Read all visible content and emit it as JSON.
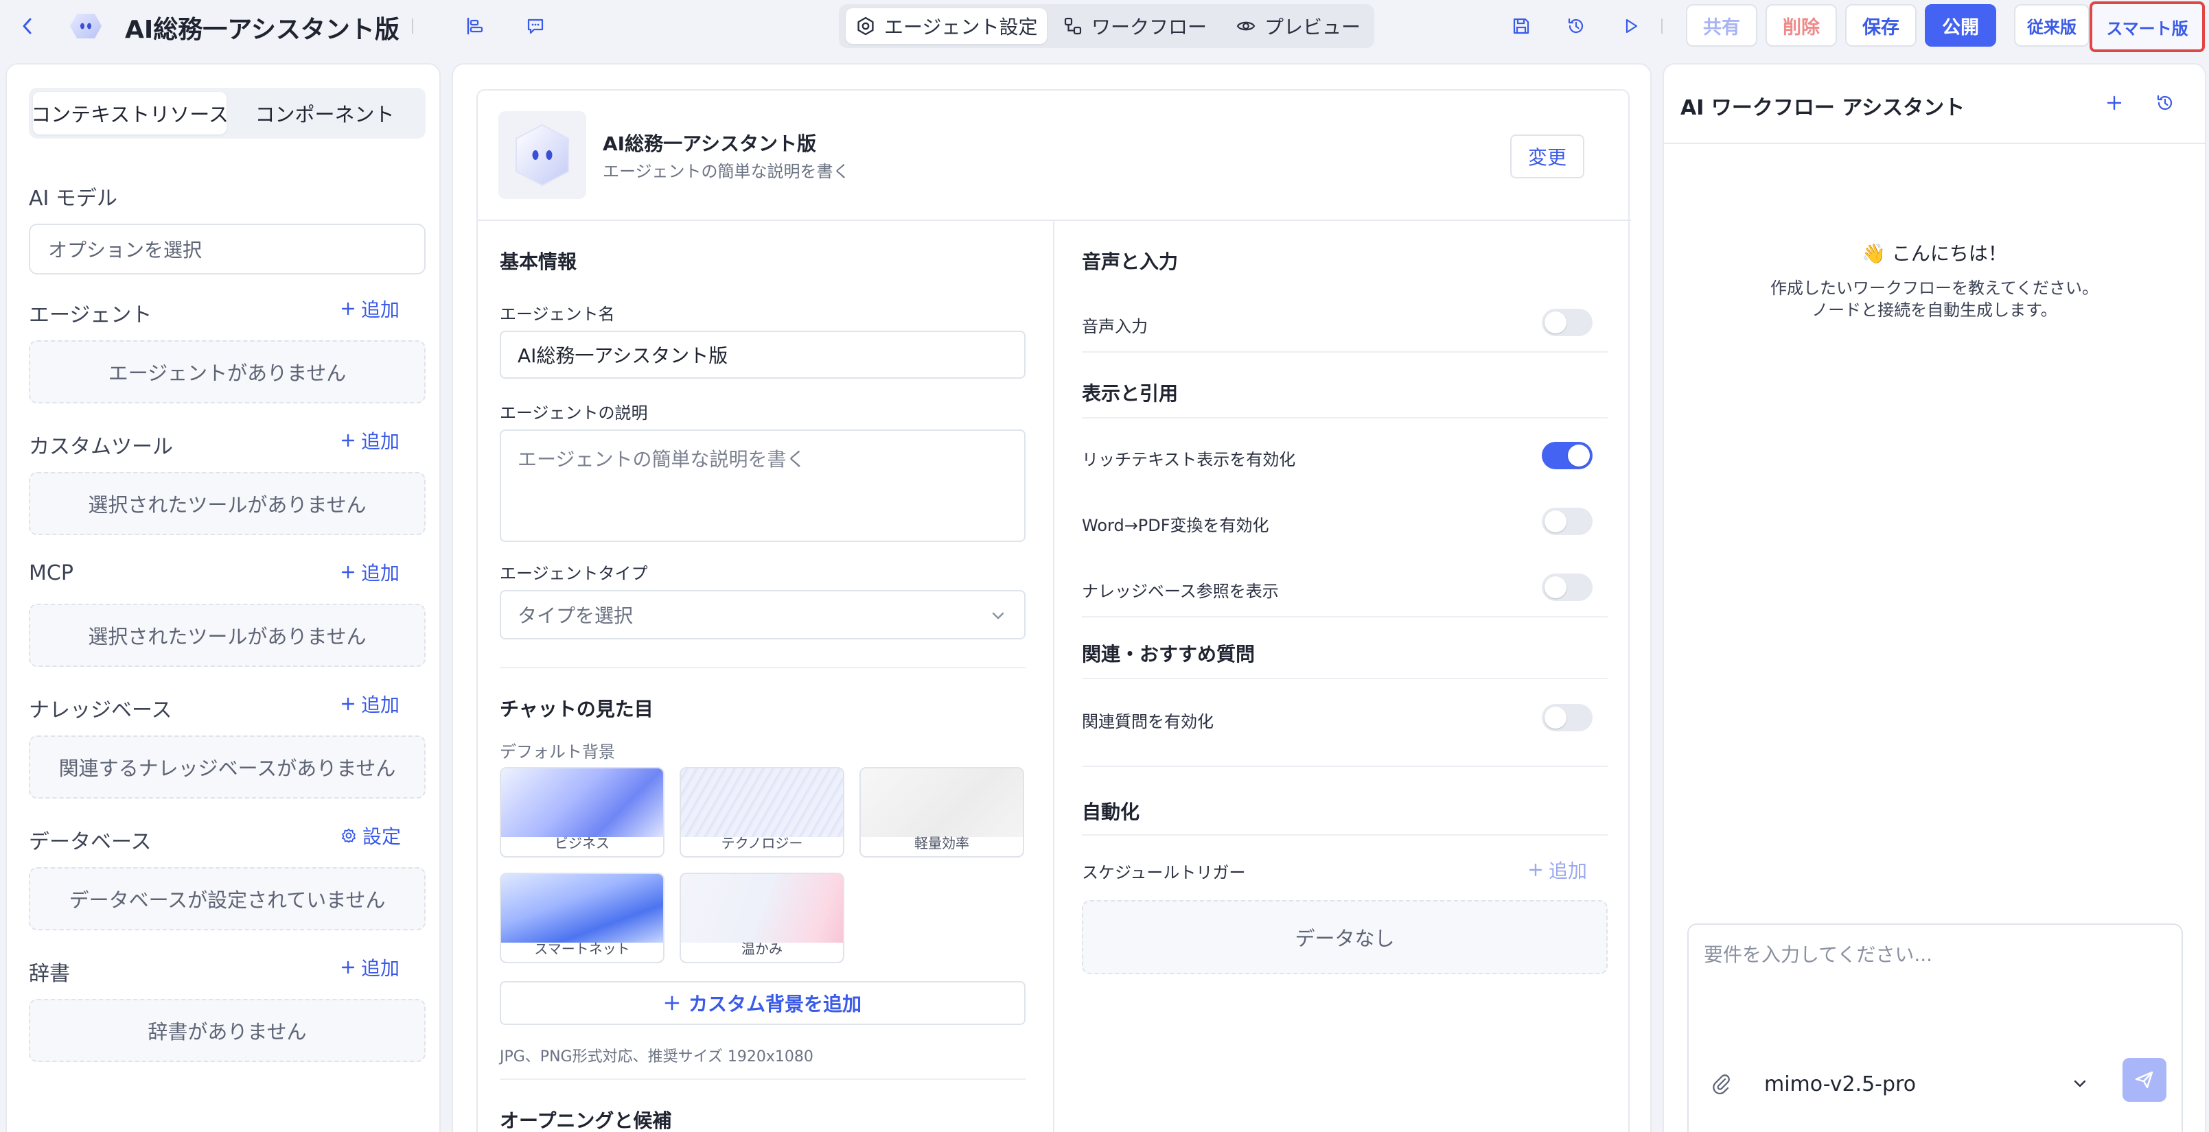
{
  "header": {
    "back_icon": "chevron-left-icon",
    "app_title": "AI総務一アシスタント版",
    "tabs": [
      {
        "label": "エージェント設定",
        "icon": "gear-icon"
      },
      {
        "label": "ワークフロー",
        "icon": "workflow-icon"
      },
      {
        "label": "プレビュー",
        "icon": "eye-icon"
      }
    ],
    "buttons": {
      "share": "共有",
      "delete": "削除",
      "save": "保存",
      "publish": "公開",
      "legacy": "従来版",
      "smart": "スマート版"
    }
  },
  "left": {
    "tabs": [
      "コンテキストリソース",
      "コンポーネント"
    ],
    "ai_model": {
      "label": "AI モデル",
      "placeholder": "オプションを選択"
    },
    "sections": [
      {
        "label": "エージェント",
        "action": "追加",
        "empty": "エージェントがありません"
      },
      {
        "label": "カスタムツール",
        "action": "追加",
        "empty": "選択されたツールがありません"
      },
      {
        "label": "MCP",
        "action": "追加",
        "empty": "選択されたツールがありません"
      },
      {
        "label": "ナレッジベース",
        "action": "追加",
        "empty": "関連するナレッジベースがありません"
      },
      {
        "label": "データベース",
        "action": "設定",
        "empty": "データベースが設定されていません"
      },
      {
        "label": "辞書",
        "action": "追加",
        "empty": "辞書がありません"
      }
    ]
  },
  "center": {
    "agent": {
      "name": "AI総務一アシスタント版",
      "description": "エージェントの簡単な説明を書く",
      "change_button": "変更"
    },
    "basic": {
      "title": "基本情報",
      "name_label": "エージェント名",
      "name_value": "AI総務一アシスタント版",
      "desc_label": "エージェントの説明",
      "desc_placeholder": "エージェントの簡単な説明を書く",
      "type_label": "エージェントタイプ",
      "type_placeholder": "タイプを選択"
    },
    "appearance": {
      "title": "チャットの見た目",
      "default_bg": "デフォルト背景",
      "backgrounds": [
        "ビジネス",
        "テクノロジー",
        "軽量効率",
        "スマートネット",
        "温かみ"
      ],
      "add_custom": "カスタム背景を追加",
      "hint": "JPG、PNG形式対応、推奨サイズ 1920x1080",
      "next_section_partial": "オープニングと候補"
    },
    "voice": {
      "title": "音声と入力",
      "items": [
        {
          "label": "音声入力",
          "on": false
        }
      ]
    },
    "display": {
      "title": "表示と引用",
      "items": [
        {
          "label": "リッチテキスト表示を有効化",
          "on": true
        },
        {
          "label": "Word→PDF変換を有効化",
          "on": false
        },
        {
          "label": "ナレッジベース参照を表示",
          "on": false
        }
      ]
    },
    "related": {
      "title": "関連・おすすめ質問",
      "items": [
        {
          "label": "関連質問を有効化",
          "on": false
        }
      ]
    },
    "automation": {
      "title": "自動化",
      "schedule_label": "スケジュールトリガー",
      "add": "追加",
      "empty": "データなし"
    }
  },
  "right": {
    "title": "AI ワークフロー アシスタント",
    "greeting": "👋 こんにちは！",
    "intro_line1": "作成したいワークフローを教えてください。",
    "intro_line2": "ノードと接続を自動生成します。",
    "input_placeholder": "要件を入力してください...",
    "model": "mimo-v2.5-pro"
  },
  "colors": {
    "accent": "#4563f2",
    "highlight_border": "#e24545",
    "delete_text": "#f08a8a"
  }
}
